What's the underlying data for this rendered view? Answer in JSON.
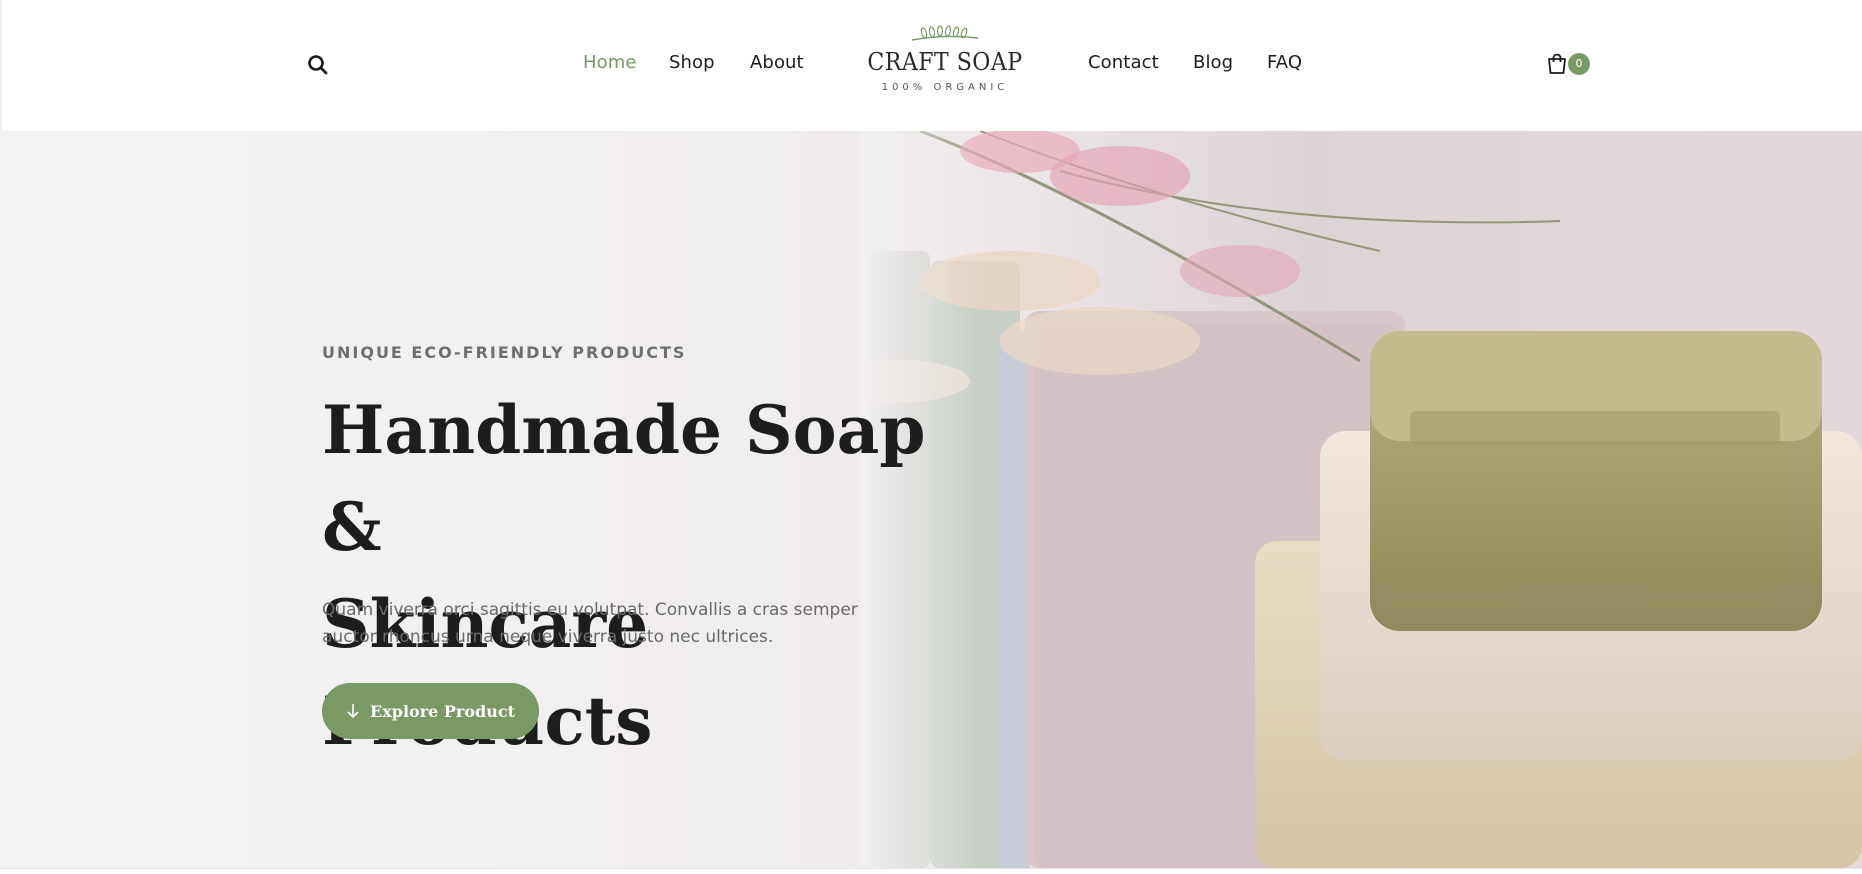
{
  "header": {
    "nav_left": [
      {
        "label": "Home",
        "active": true
      },
      {
        "label": "Shop",
        "active": false
      },
      {
        "label": "About",
        "active": false
      }
    ],
    "nav_right": [
      {
        "label": "Contact",
        "active": false
      },
      {
        "label": "Blog",
        "active": false
      },
      {
        "label": "FAQ",
        "active": false
      }
    ],
    "logo": {
      "title": "CRAFT SOAP",
      "subtitle": "100% ORGANIC"
    },
    "search_icon": "search-icon",
    "cart": {
      "icon": "shopping-bag-icon",
      "count": "0"
    }
  },
  "hero": {
    "eyebrow": "UNIQUE ECO-FRIENDLY PRODUCTS",
    "headline_line1": "Handmade Soap &",
    "headline_line2": "Skincare Products",
    "lead": "Quam viverra orci sagittis eu volutpat. Convallis a cras semper auctor rhoncus urna neque viverra justo nec ultrices.",
    "cta_label": "Explore Product",
    "cta_icon": "arrow-down-icon"
  },
  "colors": {
    "accent": "#7a9a65",
    "text_dark": "#1d1d1d",
    "text_muted": "#6a6a6a"
  }
}
